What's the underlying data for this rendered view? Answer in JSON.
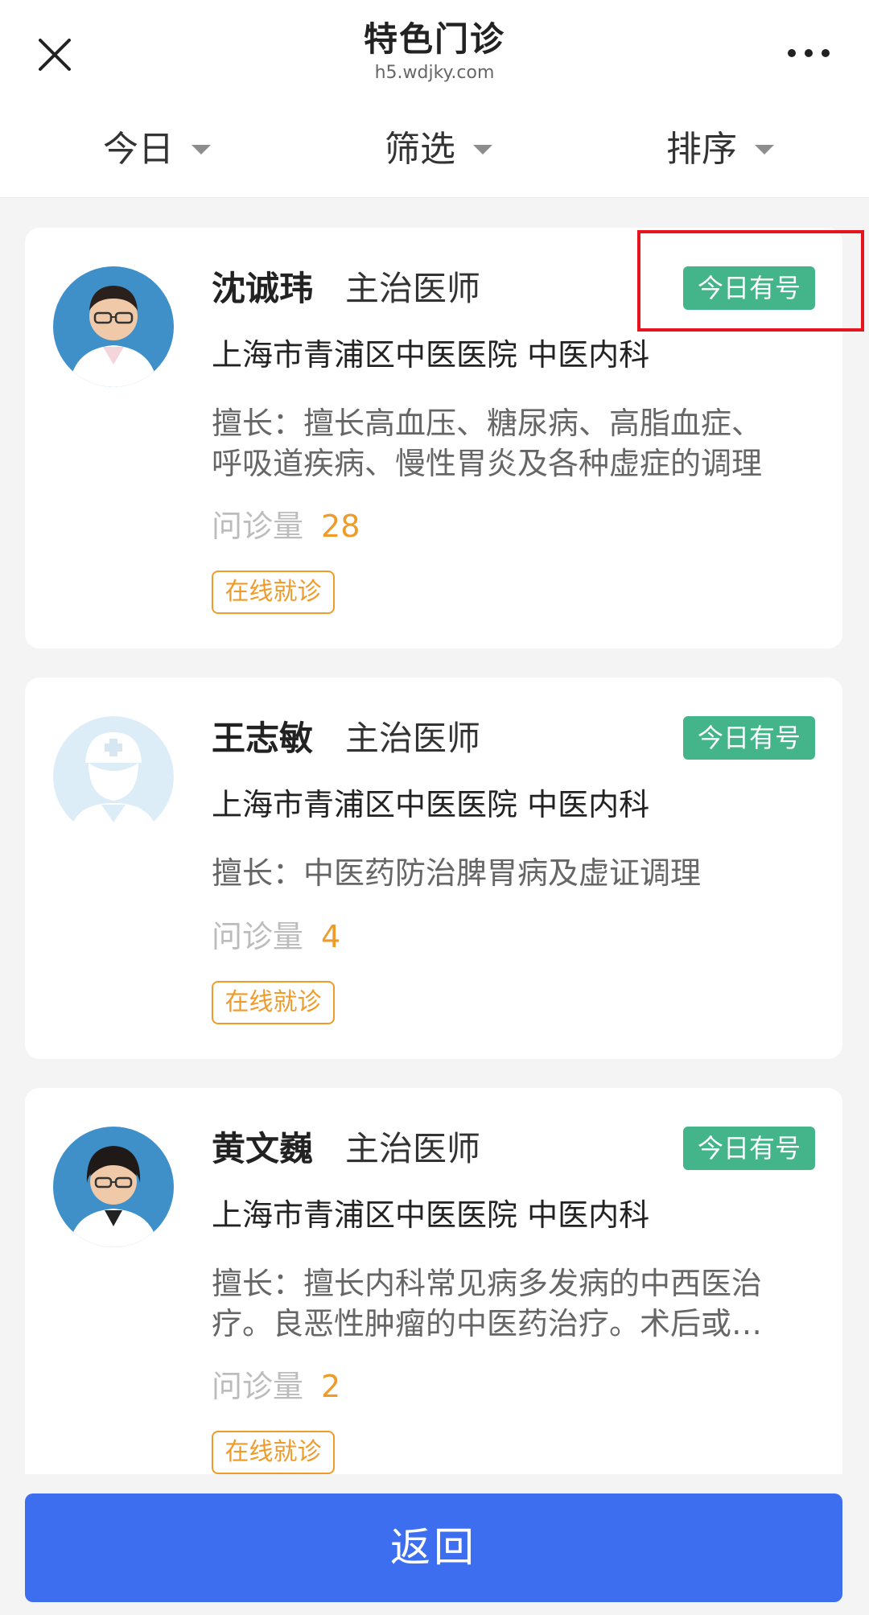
{
  "header": {
    "title": "特色门诊",
    "host": "h5.wdjky.com",
    "close_icon": "close-icon",
    "more_icon": "more-dots-icon"
  },
  "filters": [
    {
      "label": "今日"
    },
    {
      "label": "筛选"
    },
    {
      "label": "排序"
    }
  ],
  "doctors": [
    {
      "name": "沈诚玮",
      "title": "主治医师",
      "badge": "今日有号",
      "hospital": "上海市青浦区中医医院 中医内科",
      "skill_line1": "擅长：擅长高血压、糖尿病、高脂血症、",
      "skill_line2": "呼吸道疾病、慢性胃炎及各种虚症的调理",
      "consult_label": "问诊量",
      "consult_count": "28",
      "online_label": "在线就诊"
    },
    {
      "name": "王志敏",
      "title": "主治医师",
      "badge": "今日有号",
      "hospital": "上海市青浦区中医医院 中医内科",
      "skill_line1": "擅长：中医药防治脾胃病及虚证调理",
      "consult_label": "问诊量",
      "consult_count": "4",
      "online_label": "在线就诊"
    },
    {
      "name": "黄文巍",
      "title": "主治医师",
      "badge": "今日有号",
      "hospital": "上海市青浦区中医医院 中医内科",
      "skill_line1": "擅长：擅长内科常见病多发病的中西医治",
      "skill_line2": "疗。良恶性肿瘤的中医药治疗。术后或…",
      "consult_label": "问诊量",
      "consult_count": "2",
      "online_label": "在线就诊"
    }
  ],
  "footer": {
    "back_label": "返回"
  },
  "colors": {
    "badge_green": "#44b58a",
    "accent_orange": "#ef9b2a",
    "primary_blue": "#3d6ef0",
    "highlight_red": "#e6141c"
  }
}
